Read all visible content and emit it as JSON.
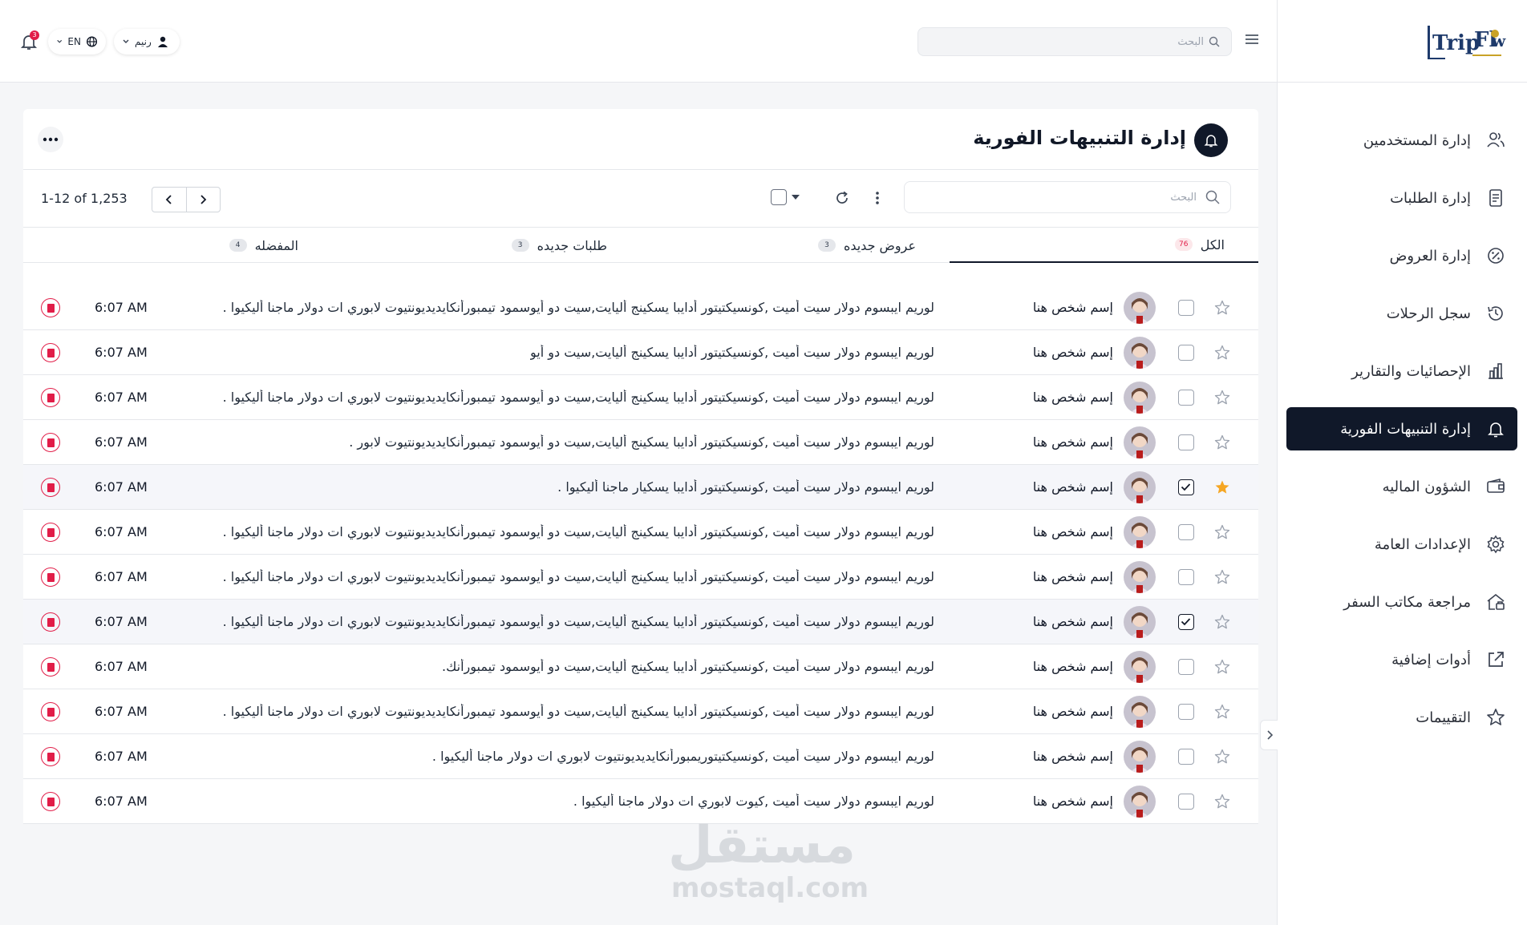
{
  "app": {
    "logo_text": "Trip Flow"
  },
  "header": {
    "search_placeholder": "البحث",
    "notification_count": "3",
    "language_label": "EN",
    "user_label": "رنيم"
  },
  "sidebar": {
    "items": [
      {
        "label": "إدارة المستخدمين",
        "icon": "users-icon",
        "active": false
      },
      {
        "label": "إدارة الطلبات",
        "icon": "document-icon",
        "active": false
      },
      {
        "label": "إدارة العروض",
        "icon": "discount-icon",
        "active": false
      },
      {
        "label": "سجل الرحلات",
        "icon": "history-icon",
        "active": false
      },
      {
        "label": "الإحصائيات والتقارير",
        "icon": "bar-chart-icon",
        "active": false
      },
      {
        "label": "إدارة التنبيهات الفورية",
        "icon": "bell-icon",
        "active": true
      },
      {
        "label": "الشؤون الماليه",
        "icon": "wallet-icon",
        "active": false
      },
      {
        "label": "الإعدادات العامة",
        "icon": "gear-icon",
        "active": false
      },
      {
        "label": "مراجعة مكاتب السفر",
        "icon": "office-review-icon",
        "active": false
      },
      {
        "label": "أدوات إضافية",
        "icon": "external-link-icon",
        "active": false
      },
      {
        "label": "التقييمات",
        "icon": "star-icon",
        "active": false
      }
    ]
  },
  "main": {
    "title": "إدارة التنبيهات الفورية",
    "search_placeholder": "البحث",
    "pagination": {
      "range": "1-12",
      "of": "of",
      "total": "1,253"
    },
    "tabs": [
      {
        "label": "الكل",
        "count": "76",
        "active": true
      },
      {
        "label": "عروض جديده",
        "count": "3",
        "active": false
      },
      {
        "label": "طلبات جديده",
        "count": "3",
        "active": false
      },
      {
        "label": "المفضله",
        "count": "4",
        "active": false
      }
    ],
    "rows": [
      {
        "sender": "إسم شخص هنا",
        "message": "لوريم ايبسوم دولار سيت أميت ,كونسيكتيتور أدايبا يسكينج أليايت,سيت دو أيوسمود تيمبورأنكايديديونتيوت لابوري ات دولار ماجنا أليكيوا .",
        "time": "6:07 AM",
        "starred": false,
        "checked": false
      },
      {
        "sender": "إسم شخص هنا",
        "message": "لوريم ايبسوم دولار سيت أميت ,كونسيكتيتور أدايبا يسكينج أليايت,سيت دو أيو",
        "time": "6:07 AM",
        "starred": false,
        "checked": false
      },
      {
        "sender": "إسم شخص هنا",
        "message": "لوريم ايبسوم دولار سيت أميت ,كونسيكتيتور أدايبا يسكينج أليايت,سيت دو أيوسمود تيمبورأنكايديديونتيوت لابوري ات دولار ماجنا أليكيوا .",
        "time": "6:07 AM",
        "starred": false,
        "checked": false
      },
      {
        "sender": "إسم شخص هنا",
        "message": "لوريم ايبسوم دولار سيت أميت ,كونسيكتيتور أدايبا يسكينج أليايت,سيت دو أيوسمود تيمبورأنكايديديونتيوت لابور .",
        "time": "6:07 AM",
        "starred": false,
        "checked": false
      },
      {
        "sender": "إسم شخص هنا",
        "message": "لوريم ايبسوم دولار سيت أميت ,كونسيكتيتور أدايبا يسكيار ماجنا أليكيوا .",
        "time": "6:07 AM",
        "starred": true,
        "checked": true
      },
      {
        "sender": "إسم شخص هنا",
        "message": "لوريم ايبسوم دولار سيت أميت ,كونسيكتيتور أدايبا يسكينج أليايت,سيت دو أيوسمود تيمبورأنكايديديونتيوت لابوري ات دولار ماجنا أليكيوا .",
        "time": "6:07 AM",
        "starred": false,
        "checked": false
      },
      {
        "sender": "إسم شخص هنا",
        "message": "لوريم ايبسوم دولار سيت أميت ,كونسيكتيتور أدايبا يسكينج أليايت,سيت دو أيوسمود تيمبورأنكايديديونتيوت لابوري ات دولار ماجنا أليكيوا .",
        "time": "6:07 AM",
        "starred": false,
        "checked": false
      },
      {
        "sender": "إسم شخص هنا",
        "message": "لوريم ايبسوم دولار سيت أميت ,كونسيكتيتور أدايبا يسكينج أليايت,سيت دو أيوسمود تيمبورأنكايديديونتيوت لابوري ات دولار ماجنا أليكيوا .",
        "time": "6:07 AM",
        "starred": false,
        "checked": true
      },
      {
        "sender": "إسم شخص هنا",
        "message": "لوريم ايبسوم دولار سيت أميت ,كونسيكتيتور أدايبا يسكينج أليايت,سيت دو أيوسمود تيمبورأنك.",
        "time": "6:07 AM",
        "starred": false,
        "checked": false
      },
      {
        "sender": "إسم شخص هنا",
        "message": "لوريم ايبسوم دولار سيت أميت ,كونسيكتيتور أدايبا يسكينج أليايت,سيت دو أيوسمود تيمبورأنكايديديونتيوت لابوري ات دولار ماجنا أليكيوا .",
        "time": "6:07 AM",
        "starred": false,
        "checked": false
      },
      {
        "sender": "إسم شخص هنا",
        "message": "لوريم ايبسوم دولار سيت أميت ,كونسيكتيتوريمبورأنكايديديونتيوت لابوري ات دولار ماجنا أليكيوا .",
        "time": "6:07 AM",
        "starred": false,
        "checked": false
      },
      {
        "sender": "إسم شخص هنا",
        "message": "لوريم ايبسوم دولار سيت أميت ,كيوت لابوري ات دولار ماجنا أليكيوا .",
        "time": "6:07 AM",
        "starred": false,
        "checked": false
      }
    ]
  },
  "watermark": {
    "arabic": "مستقل",
    "latin": "mostaql.com"
  },
  "colors": {
    "sidebar_active": "#101829",
    "accent_gold": "#c9a227",
    "star_active": "#f5a623",
    "delete_red": "#e11d48",
    "badge_red": "#e11d48"
  }
}
